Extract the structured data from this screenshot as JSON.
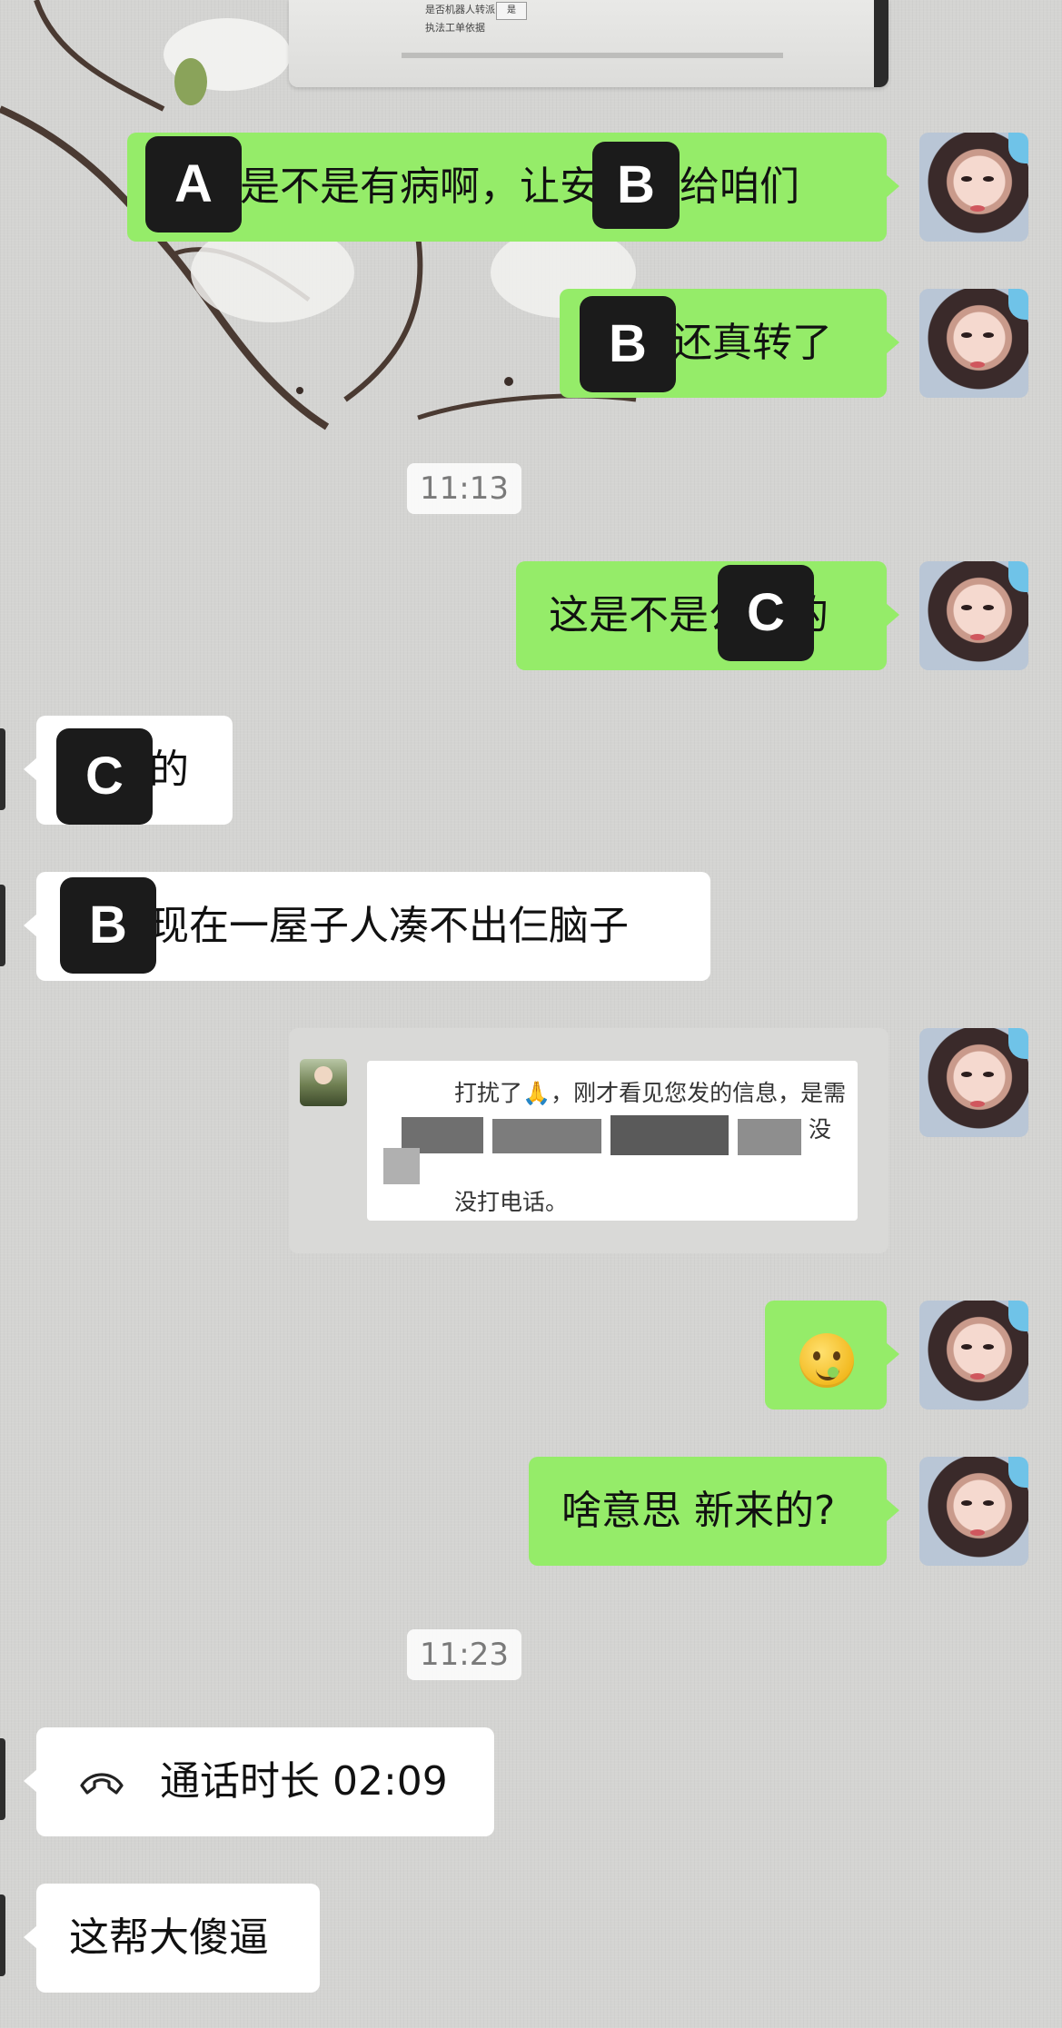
{
  "screenshot_fragment": {
    "line1": "是否机器人转派",
    "line2": "执法工单依据",
    "select_value": "是"
  },
  "messages": [
    {
      "side": "me",
      "text": "中心是不是有病啊，让安监转给咱们"
    },
    {
      "side": "me",
      "text": "安监还真转了"
    },
    {
      "side": "me",
      "text": "这是不是公路的"
    },
    {
      "side": "them",
      "text": "公路的"
    },
    {
      "side": "them",
      "text": "安监现在一屋子人凑不出仨脑子"
    },
    {
      "side": "me",
      "text": "啥意思 新来的?"
    },
    {
      "side": "them",
      "text": "这帮大傻逼"
    }
  ],
  "timestamps": [
    "11:13",
    "11:23"
  ],
  "forwarded_card": {
    "line1": "打扰了🙏，刚才看见您发的信息，是需",
    "line2": "没",
    "line3": "没打电话。"
  },
  "emoji_message": "yum-face-emoji",
  "call": {
    "label": "通话时长 02:09"
  },
  "tags": {
    "a": "A",
    "b": "B",
    "c": "C"
  },
  "colors": {
    "my_bubble": "#95ec69",
    "their_bubble": "#ffffff",
    "tag_bg": "#1b1b1b"
  }
}
